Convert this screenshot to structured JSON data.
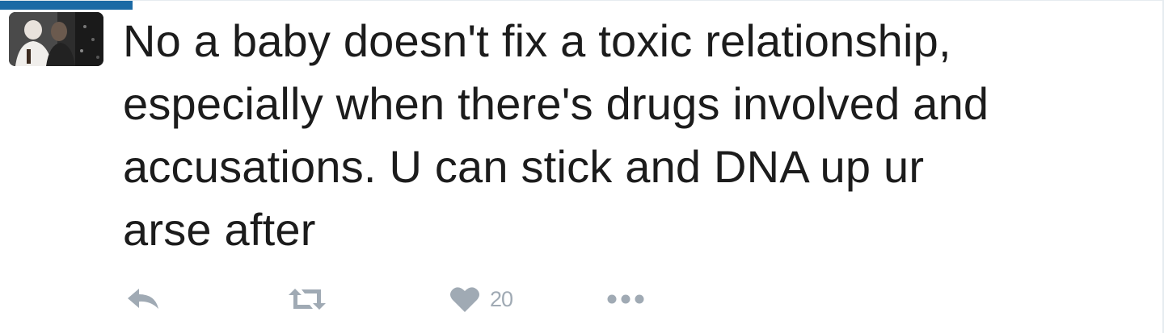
{
  "tweet": {
    "lines": [
      "No a baby doesn't fix a toxic relationship,",
      "especially when there's drugs involved and",
      "accusations. U can stick and DNA up ur",
      "arse after"
    ],
    "avatar_icon": "profile-photo",
    "progress_color": "#1b6aa5"
  },
  "actions": {
    "reply_icon": "reply-icon",
    "retweet_icon": "retweet-icon",
    "like_icon": "heart-icon",
    "like_count": "20",
    "more_icon": "more-dots-icon",
    "icon_color": "#a0aab4"
  }
}
